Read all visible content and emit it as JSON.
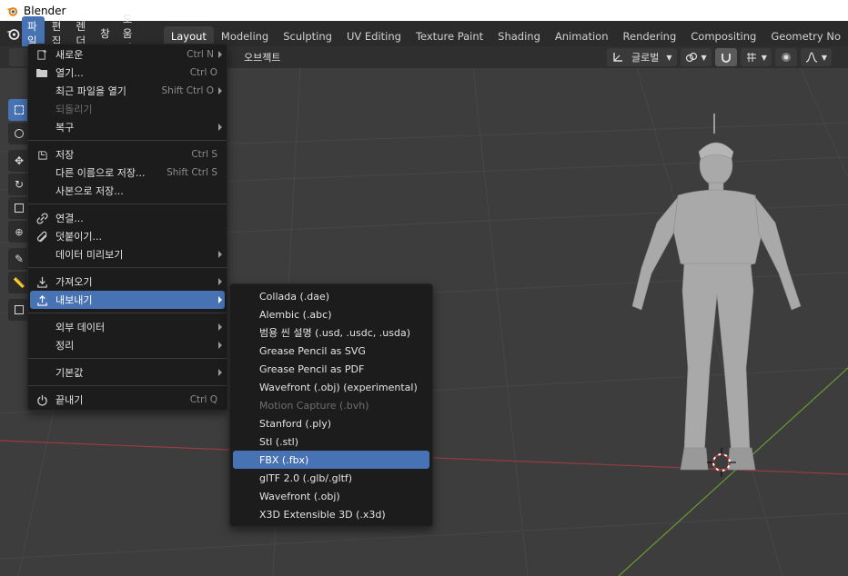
{
  "os": {
    "title": "Blender"
  },
  "menubar": {
    "items": [
      "파일",
      "편집",
      "렌더",
      "창",
      "도움말"
    ],
    "active_index": 0
  },
  "workspaces": {
    "tabs": [
      "Layout",
      "Modeling",
      "Sculpting",
      "UV Editing",
      "Texture Paint",
      "Shading",
      "Animation",
      "Rendering",
      "Compositing",
      "Geometry No"
    ],
    "active_index": 0
  },
  "viewport_header": {
    "object_label": "오브젝트",
    "transform_orientation": "글로벌"
  },
  "file_menu": {
    "items": [
      {
        "label": "새로운",
        "shortcut": "Ctrl N",
        "submenu": true,
        "icon": "new-file-icon"
      },
      {
        "label": "열기...",
        "shortcut": "Ctrl O",
        "icon": "folder-icon"
      },
      {
        "label": "최근 파일을 열기",
        "shortcut": "Shift Ctrl O",
        "submenu": true
      },
      {
        "label": "되돌리기",
        "disabled": true
      },
      {
        "label": "복구",
        "submenu": true
      },
      {
        "separator": true
      },
      {
        "label": "저장",
        "shortcut": "Ctrl S",
        "icon": "save-icon"
      },
      {
        "label": "다른 이름으로 저장...",
        "shortcut": "Shift Ctrl S"
      },
      {
        "label": "사본으로 저장..."
      },
      {
        "separator": true
      },
      {
        "label": "연결...",
        "icon": "link-icon"
      },
      {
        "label": "덧붙이기...",
        "icon": "append-icon"
      },
      {
        "label": "데이터 미리보기",
        "submenu": true
      },
      {
        "separator": true
      },
      {
        "label": "가져오기",
        "submenu": true,
        "icon": "import-icon"
      },
      {
        "label": "내보내기",
        "submenu": true,
        "icon": "export-icon",
        "highlighted": true
      },
      {
        "separator": true
      },
      {
        "label": "외부 데이터",
        "submenu": true
      },
      {
        "label": "정리",
        "submenu": true
      },
      {
        "separator": true
      },
      {
        "label": "기본값",
        "submenu": true
      },
      {
        "separator": true
      },
      {
        "label": "끝내기",
        "shortcut": "Ctrl Q",
        "icon": "quit-icon"
      }
    ]
  },
  "export_menu": {
    "items": [
      {
        "label": "Collada (.dae)"
      },
      {
        "label": "Alembic (.abc)"
      },
      {
        "label": "범용 씬 설명 (.usd, .usdc, .usda)"
      },
      {
        "label": "Grease Pencil as SVG"
      },
      {
        "label": "Grease Pencil as PDF"
      },
      {
        "label": "Wavefront (.obj) (experimental)"
      },
      {
        "label": "Motion Capture (.bvh)",
        "disabled": true
      },
      {
        "label": "Stanford (.ply)"
      },
      {
        "label": "Stl (.stl)"
      },
      {
        "label": "FBX (.fbx)",
        "highlighted": true
      },
      {
        "label": "glTF 2.0 (.glb/.gltf)"
      },
      {
        "label": "Wavefront (.obj)"
      },
      {
        "label": "X3D Extensible 3D (.x3d)"
      }
    ]
  },
  "colors": {
    "accent": "#4772b3",
    "menu_bg": "#1c1c1c",
    "viewport_bg": "#3d3d3d",
    "x_axis": "#9b3a44",
    "y_axis": "#6a9a33"
  }
}
